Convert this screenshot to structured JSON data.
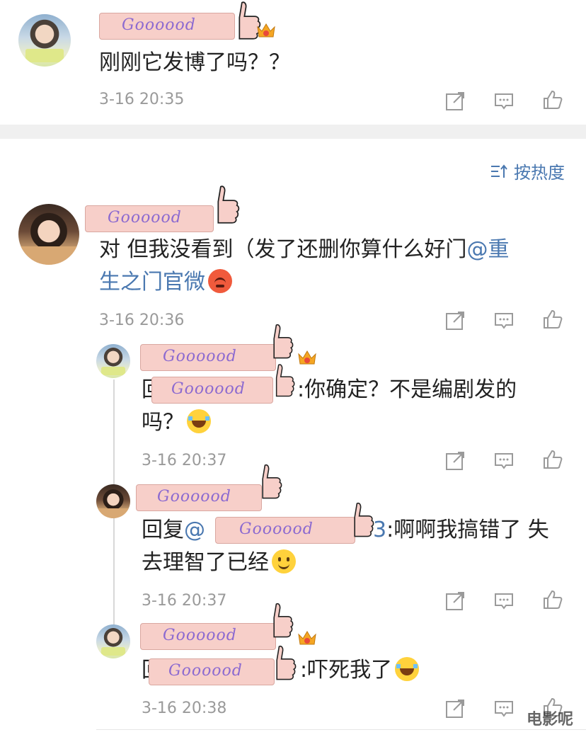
{
  "sort_label": "按热度",
  "watermark": "电影呢",
  "sticker_word": "Goooood",
  "colors": {
    "link": "#4a78b0",
    "time": "#9a9a9a",
    "divider": "#f0f0f0"
  },
  "comments": [
    {
      "text": "刚刚它发博了吗？？",
      "time": "3-16 20:35"
    },
    {
      "text_line1_a": "对 但我没看到（发了还删你算什么好门",
      "mention_a": "@重",
      "mention_b": "生之门官微",
      "time": "3-16 20:36"
    }
  ],
  "replies": [
    {
      "prefix": "回",
      "text_line1": ":你确定？不是编剧发的",
      "text_line2": "吗？",
      "time": "3-16 20:37"
    },
    {
      "prefix": "回复",
      "mention_start": "@",
      "mention_end": "3",
      "text_line1": ":啊啊我搞错了 失",
      "text_line2": "去理智了已经",
      "time": "3-16 20:37"
    },
    {
      "prefix": "回",
      "text_line1": ":吓死我了",
      "time": "3-16 20:38"
    }
  ],
  "icons": [
    "share-icon",
    "comment-icon",
    "like-icon"
  ]
}
